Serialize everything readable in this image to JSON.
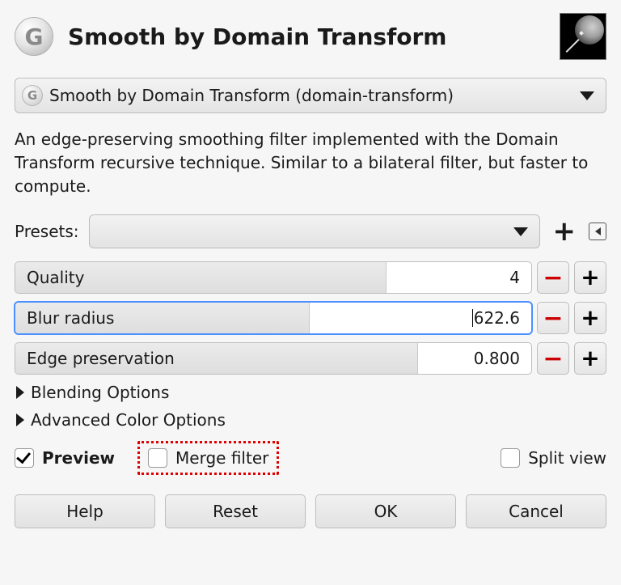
{
  "header": {
    "title": "Smooth by Domain Transform",
    "app_icon_glyph": "G"
  },
  "operation": {
    "icon_glyph": "G",
    "label": "Smooth by Domain Transform (domain-transform)"
  },
  "description": "An edge-preserving smoothing filter implemented with the Domain Transform recursive technique. Similar to a bilateral filter, but faster to compute.",
  "presets": {
    "label": "Presets:",
    "selected": ""
  },
  "params": {
    "quality": {
      "label": "Quality",
      "value": "4",
      "fill_pct": 72
    },
    "blur": {
      "label": "Blur radius",
      "value": "622.6",
      "fill_pct": 57,
      "focused": true
    },
    "edge": {
      "label": "Edge preservation",
      "value": "0.800",
      "fill_pct": 78
    }
  },
  "expanders": {
    "blending": "Blending Options",
    "color": "Advanced Color Options"
  },
  "checks": {
    "preview": {
      "label": "Preview",
      "checked": true
    },
    "merge": {
      "label": "Merge filter",
      "checked": false,
      "highlighted": true
    },
    "split_view": {
      "label": "Split view",
      "checked": false
    }
  },
  "buttons": {
    "help": "Help",
    "reset": "Reset",
    "ok": "OK",
    "cancel": "Cancel"
  }
}
